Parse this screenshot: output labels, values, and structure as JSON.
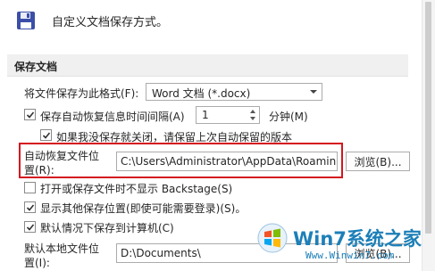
{
  "header": {
    "text": "自定义文档保存方式。",
    "icon": "save-floppy-icon"
  },
  "section": {
    "title": "保存文档"
  },
  "format": {
    "label": "将文件保存为此格式(F):",
    "value": "Word 文档 (*.docx)"
  },
  "autorecover": {
    "label": "保存自动恢复信息时间间隔(A)",
    "checked": true,
    "minutes": "1",
    "unit": "分钟(M)"
  },
  "keep_last": {
    "label": "如果我没保存就关闭，请保留上次自动保留的版本",
    "checked": true
  },
  "autorecover_location": {
    "label_line1": "自动恢复文件位",
    "label_line2": "置(R):",
    "value": "C:\\Users\\Administrator\\AppData\\Roaming\\Microsoft\\Word\\",
    "browse": "浏览(B)...",
    "highlight_color": "#d4161f"
  },
  "options": [
    {
      "label": "打开或保存文件时不显示 Backstage(S)",
      "checked": false
    },
    {
      "label": "显示其他保存位置(即使可能需要登录)(S)。",
      "checked": true
    },
    {
      "label": "默认情况下保存到计算机(C)",
      "checked": true
    }
  ],
  "local_location": {
    "label_line1": "默认本地文件位",
    "label_line2": "置(I):",
    "value": "D:\\Documents\\",
    "browse": "浏览(B)..."
  },
  "watermark": {
    "title": "Win7系统之家",
    "url": "Www.Winwin7.com"
  }
}
